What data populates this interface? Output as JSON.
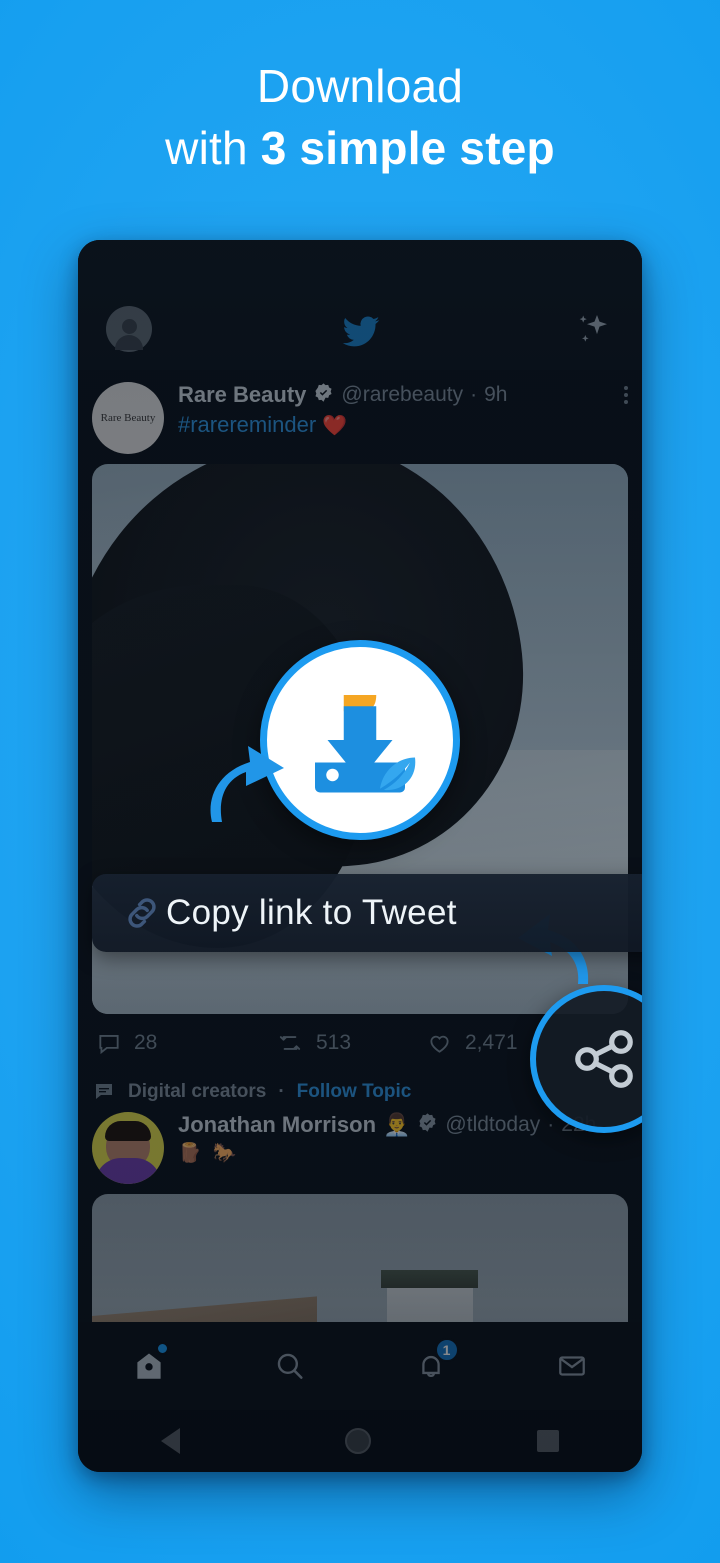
{
  "promo": {
    "line1": "Download",
    "line2_prefix": "with ",
    "line2_bold": "3 simple step"
  },
  "colors": {
    "background_blue": "#1CA2F1",
    "accent_blue": "#1D9BF0",
    "twitter_blue": "#2F8FD6",
    "app_surface": "#0D141C",
    "muted_text": "#7B8996",
    "icon_orange": "#F5A623"
  },
  "phone": {
    "topbar": {
      "avatar_icon": "account-avatar-icon",
      "logo_icon": "twitter-bird-icon",
      "sparkle_icon": "sparkle-icon"
    },
    "tweets": [
      {
        "avatar_label": "Rare Beauty",
        "display_name": "Rare Beauty",
        "verified": true,
        "handle": "@rarebeauty",
        "separator": "·",
        "timestamp": "9h",
        "text": "#rarereminder",
        "text_emoji": "❤️",
        "more_icon": "overflow-menu-icon",
        "media_alt": "woman-profile-photo",
        "stats": {
          "replies_icon": "reply-icon",
          "replies": "28",
          "retweets_icon": "retweet-icon",
          "retweets": "513",
          "likes_icon": "like-heart-icon",
          "likes": "2,471"
        }
      },
      {
        "topic_icon": "topic-bubble-icon",
        "topic_label": "Digital creators",
        "topic_separator": "·",
        "topic_action": "Follow Topic",
        "display_name": "Jonathan Morrison",
        "name_emoji": "👨‍💼",
        "verified": true,
        "handle": "@tldtoday",
        "separator": "·",
        "timestamp": "22h",
        "body_emoji": "🪵 🐎",
        "media_alt": "rooftops-chimneys-photo"
      }
    ],
    "bottom_nav": [
      {
        "icon": "home-icon",
        "label": "Home",
        "badge_dot": true
      },
      {
        "icon": "search-icon",
        "label": "Search",
        "badge_dot": false
      },
      {
        "icon": "notifications-bell-icon",
        "label": "Notifications",
        "badge_count": "1"
      },
      {
        "icon": "messages-envelope-icon",
        "label": "Messages",
        "badge_dot": false
      }
    ],
    "system_nav": [
      {
        "icon": "android-back-icon",
        "label": "Back"
      },
      {
        "icon": "android-home-icon",
        "label": "Home"
      },
      {
        "icon": "android-recents-icon",
        "label": "Recents"
      }
    ]
  },
  "overlays": {
    "copy_banner": {
      "icon": "link-chain-icon",
      "label": "Copy link to Tweet"
    },
    "app_icon": {
      "name": "download-app-icon"
    },
    "share_button": {
      "icon": "share-nodes-icon"
    },
    "arrows": [
      {
        "name": "pointer-arrow-to-app-icon"
      },
      {
        "name": "pointer-arrow-to-copy-banner"
      }
    ]
  }
}
